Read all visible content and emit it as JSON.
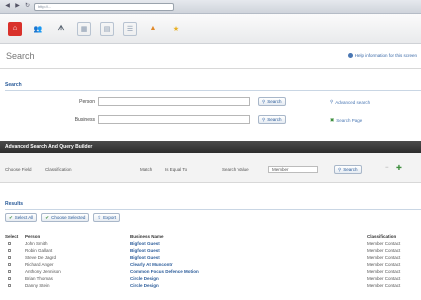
{
  "browser": {
    "url": "http://..."
  },
  "toolbar": {
    "icons": [
      {
        "name": "home-icon",
        "color": "#d9312b"
      },
      {
        "name": "people-icon",
        "color": "#6f7f94"
      },
      {
        "name": "users-icon",
        "color": "#55606e"
      },
      {
        "name": "grid-icon",
        "color": "#8798ae"
      },
      {
        "name": "calendar-icon",
        "color": "#8798ae"
      },
      {
        "name": "list-icon",
        "color": "#8798ae"
      },
      {
        "name": "alert-icon",
        "color": "#e0892a"
      },
      {
        "name": "star-icon",
        "color": "#e8b025"
      }
    ]
  },
  "header": {
    "title": "Search",
    "help_link": "Help information for this screen"
  },
  "search": {
    "title": "Search",
    "person_label": "Person",
    "business_label": "Business",
    "search_button": "Search",
    "advanced_link": "Advanced search",
    "search_page_link": "Search Page"
  },
  "advanced": {
    "title": "Advanced Search And Query Builder",
    "field_label": "Choose Field",
    "field_value": "Classification",
    "match_label": "Match",
    "match_value": "Is Equal To",
    "value_label": "Search Value",
    "value_value": "Member",
    "search_button": "Search"
  },
  "results": {
    "title": "Results",
    "buttons": [
      "Select All",
      "Choose Selected",
      "Export"
    ],
    "columns": [
      "Select",
      "Person",
      "Business Name",
      "Classification"
    ],
    "rows": [
      {
        "person": "John Smith",
        "business": "Bigfoot Guest",
        "classification": "Member Contact"
      },
      {
        "person": "Robin Gallant",
        "business": "Bigfoot Guest",
        "classification": "Member Contact"
      },
      {
        "person": "Steve De Jagrd",
        "business": "Bigfoot Guest",
        "classification": "Member Contact"
      },
      {
        "person": "Richard Anger",
        "business": "Clearly At Muncontr",
        "classification": "Member Contact"
      },
      {
        "person": "Anthony Jennison",
        "business": "Common Focus Defence Motion",
        "classification": "Member Contact"
      },
      {
        "person": "Brian Thomas",
        "business": "Circle Design",
        "classification": "Member Contact"
      },
      {
        "person": "Danny Stein",
        "business": "Circle Design",
        "classification": "Member Contact"
      }
    ]
  }
}
